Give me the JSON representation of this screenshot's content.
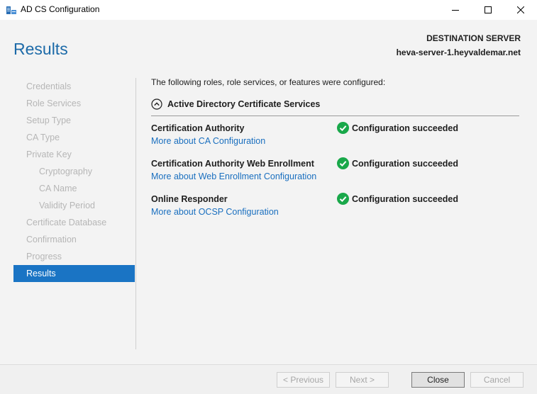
{
  "window": {
    "title": "AD CS Configuration"
  },
  "header": {
    "page_title": "Results",
    "dest_label": "DESTINATION SERVER",
    "dest_server": "heva-server-1.heyvaldemar.net"
  },
  "nav": {
    "items": [
      {
        "label": "Credentials"
      },
      {
        "label": "Role Services"
      },
      {
        "label": "Setup Type"
      },
      {
        "label": "CA Type"
      },
      {
        "label": "Private Key"
      },
      {
        "label": "Cryptography"
      },
      {
        "label": "CA Name"
      },
      {
        "label": "Validity Period"
      },
      {
        "label": "Certificate Database"
      },
      {
        "label": "Confirmation"
      },
      {
        "label": "Progress"
      },
      {
        "label": "Results"
      }
    ]
  },
  "main": {
    "intro": "The following roles, role services, or features were configured:",
    "section_title": "Active Directory Certificate Services",
    "rows": [
      {
        "name": "Certification Authority",
        "link": "More about CA Configuration",
        "status": "Configuration succeeded"
      },
      {
        "name": "Certification Authority Web Enrollment",
        "link": "More about Web Enrollment Configuration",
        "status": "Configuration succeeded"
      },
      {
        "name": "Online Responder",
        "link": "More about OCSP Configuration",
        "status": "Configuration succeeded"
      }
    ]
  },
  "footer": {
    "previous": "< Previous",
    "next": "Next >",
    "close": "Close",
    "cancel": "Cancel"
  },
  "colors": {
    "accent": "#1a74c4",
    "title": "#1c6aa8",
    "link": "#1a6fbf",
    "success": "#19a84a"
  }
}
